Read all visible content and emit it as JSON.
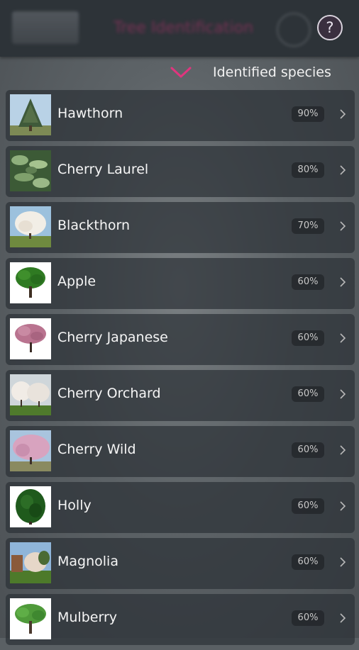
{
  "header": {
    "app_title": "Tree Identification",
    "help_label": "?",
    "section_label": "Identified species",
    "accent_color": "#e0357e"
  },
  "species": [
    {
      "name": "Hawthorn",
      "match": "90%",
      "image": "conifer-photo"
    },
    {
      "name": "Cherry Laurel",
      "match": "80%",
      "image": "laurel-leaves-photo"
    },
    {
      "name": "Blackthorn",
      "match": "70%",
      "image": "blossom-tree-photo"
    },
    {
      "name": "Apple",
      "match": "60%",
      "image": "green-tree-photo"
    },
    {
      "name": "Cherry Japanese",
      "match": "60%",
      "image": "pink-tree-photo"
    },
    {
      "name": "Cherry Orchard",
      "match": "60%",
      "image": "white-orchard-photo"
    },
    {
      "name": "Cherry Wild",
      "match": "60%",
      "image": "pink-blossom-photo"
    },
    {
      "name": "Holly",
      "match": "60%",
      "image": "holly-bush-photo"
    },
    {
      "name": "Magnolia",
      "match": "60%",
      "image": "magnolia-park-photo"
    },
    {
      "name": "Mulberry",
      "match": "60%",
      "image": "mulberry-tree-photo"
    }
  ]
}
